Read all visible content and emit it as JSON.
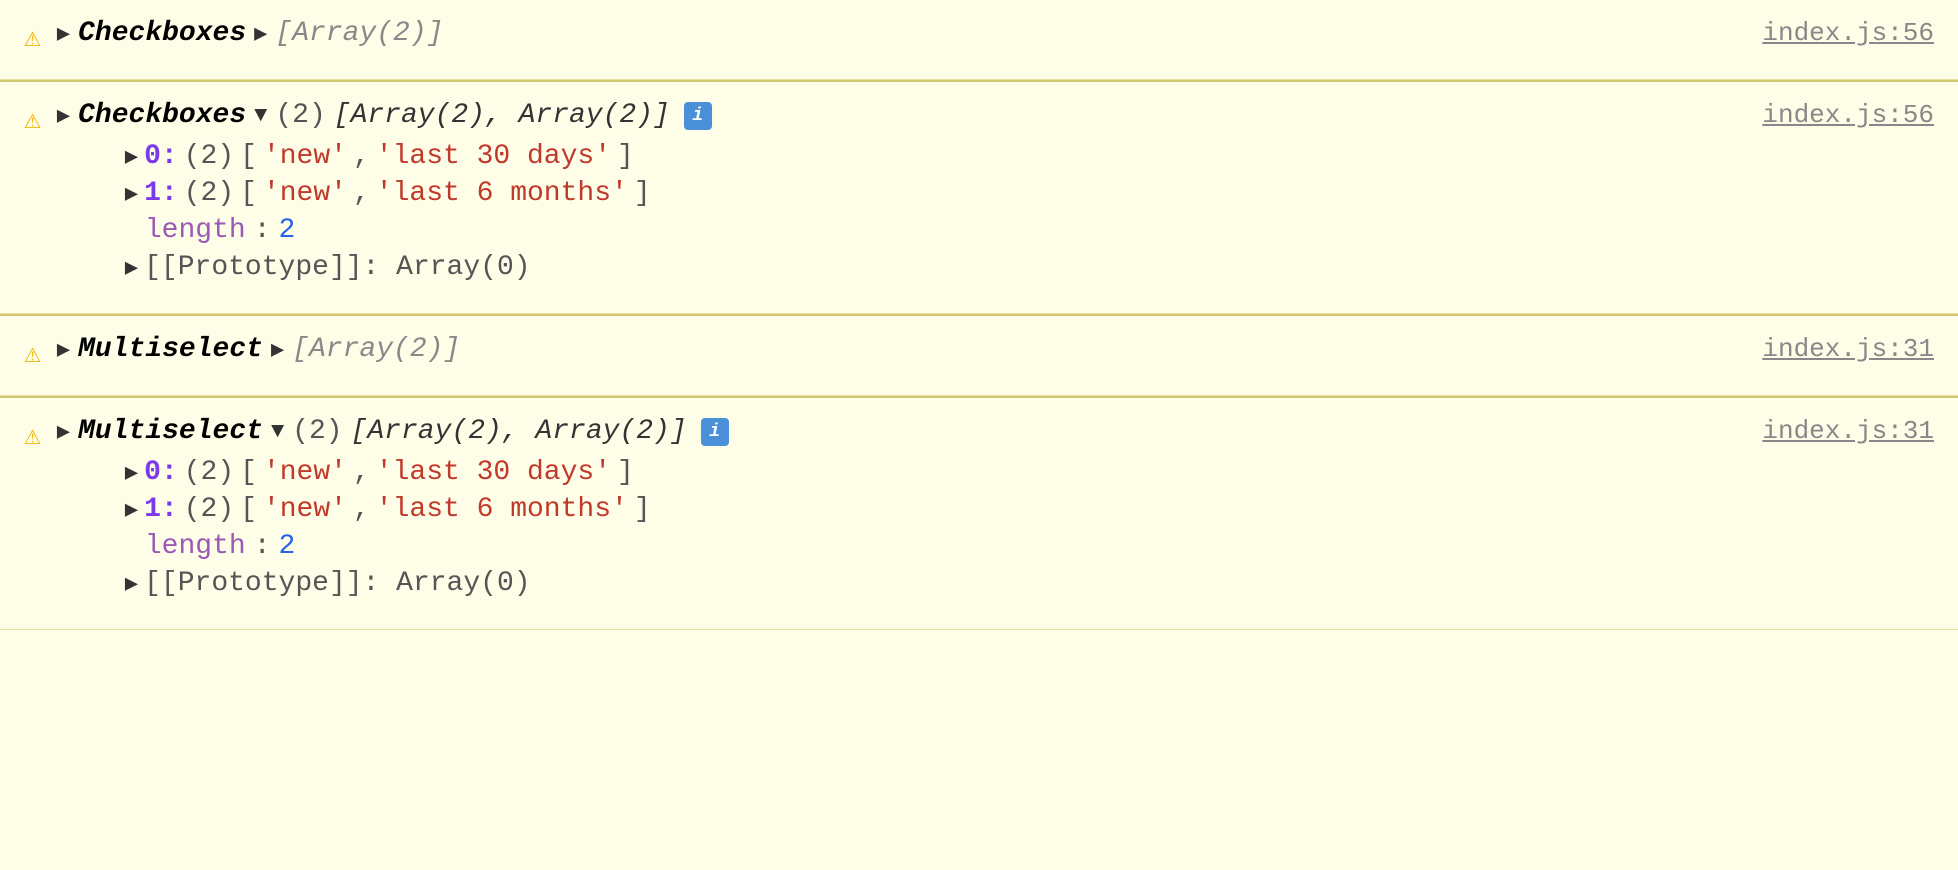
{
  "console": {
    "blocks": [
      {
        "id": "checkboxes-collapsed",
        "warning_icon": "⚠",
        "triangle": "▶",
        "component": "Checkboxes",
        "separator": "▶",
        "array_text": "[Array(2)]",
        "file_link": "index.js:56",
        "expanded": false
      },
      {
        "id": "checkboxes-expanded",
        "warning_icon": "⚠",
        "triangle": "▼",
        "component": "Checkboxes",
        "separator": "▼",
        "count": "(2)",
        "array_items_label": "[Array(2), Array(2)]",
        "has_info": true,
        "file_link": "index.js:56",
        "expanded": true,
        "items": [
          {
            "index": "0",
            "count": "(2)",
            "values": [
              "'new'",
              "'last 30 days'"
            ]
          },
          {
            "index": "1",
            "count": "(2)",
            "values": [
              "'new'",
              "'last 6 months'"
            ]
          }
        ],
        "length_label": "length",
        "length_value": "2",
        "prototype_text": "[[Prototype]]: Array(0)"
      },
      {
        "id": "multiselect-collapsed",
        "warning_icon": "⚠",
        "triangle": "▶",
        "component": "Multiselect",
        "separator": "▶",
        "array_text": "[Array(2)]",
        "file_link": "index.js:31",
        "expanded": false
      },
      {
        "id": "multiselect-expanded",
        "warning_icon": "⚠",
        "triangle": "▼",
        "component": "Multiselect",
        "separator": "▼",
        "count": "(2)",
        "array_items_label": "[Array(2), Array(2)]",
        "has_info": true,
        "file_link": "index.js:31",
        "expanded": true,
        "items": [
          {
            "index": "0",
            "count": "(2)",
            "values": [
              "'new'",
              "'last 30 days'"
            ]
          },
          {
            "index": "1",
            "count": "(2)",
            "values": [
              "'new'",
              "'last 6 months'"
            ]
          }
        ],
        "length_label": "length",
        "length_value": "2",
        "prototype_text": "[[Prototype]]: Array(0)"
      }
    ],
    "info_badge_label": "i",
    "triangle_right_symbol": "▶",
    "triangle_down_symbol": "▼"
  }
}
